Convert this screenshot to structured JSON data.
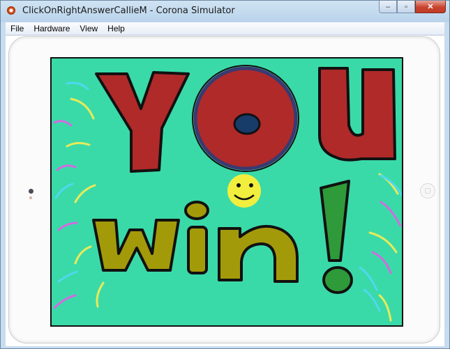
{
  "window": {
    "title": "ClickOnRightAnswerCallieM - Corona Simulator",
    "buttons": {
      "minimize": "–",
      "maximize": "▫",
      "close": "✕"
    }
  },
  "menu": [
    "File",
    "Hardware",
    "View",
    "Help"
  ],
  "screen": {
    "background": "#3adaa8",
    "word1": "YOU",
    "word2": "win!",
    "colors": {
      "you_fill": "#b02a2a",
      "o_ring": "#3a3a70",
      "win_fill": "#a39a0a",
      "exclaim_fill": "#2f9a3a",
      "smiley": "#f2ee3e"
    }
  }
}
